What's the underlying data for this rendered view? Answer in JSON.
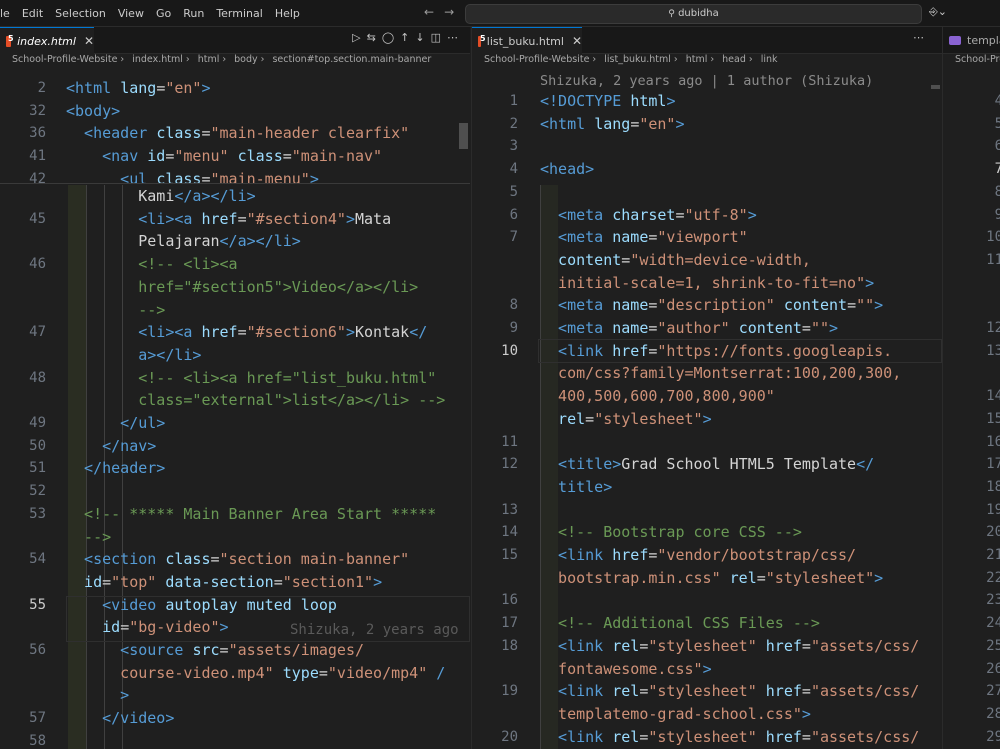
{
  "menu": [
    "le",
    "Edit",
    "Selection",
    "View",
    "Go",
    "Run",
    "Terminal",
    "Help"
  ],
  "search": "dubidha",
  "left": {
    "tab": "index.html",
    "breadcrumb": [
      "School-Profile-Website",
      "index.html",
      "html",
      "body",
      "section#top.section.main-banner"
    ],
    "sticky": [
      {
        "n": "2",
        "t": [
          [
            "tag",
            "<html "
          ],
          [
            "atn",
            "lang"
          ],
          [
            "pl",
            "="
          ],
          [
            "str",
            "\"en\""
          ],
          [
            "tag",
            ">"
          ]
        ]
      },
      {
        "n": "32",
        "t": [
          [
            "tag",
            "<body>"
          ]
        ]
      },
      {
        "n": "36",
        "t": [
          [
            "tag",
            "  <header "
          ],
          [
            "atn",
            "class"
          ],
          [
            "pl",
            "="
          ],
          [
            "str",
            "\"main-header clearfix\""
          ]
        ]
      },
      {
        "n": "41",
        "t": [
          [
            "tag",
            "    <nav "
          ],
          [
            "atn",
            "id"
          ],
          [
            "pl",
            "="
          ],
          [
            "str",
            "\"menu\" "
          ],
          [
            "atn",
            "class"
          ],
          [
            "pl",
            "="
          ],
          [
            "str",
            "\"main-nav\""
          ]
        ]
      },
      {
        "n": "42",
        "t": [
          [
            "tag",
            "      <ul "
          ],
          [
            "atn",
            "class"
          ],
          [
            "pl",
            "="
          ],
          [
            "str",
            "\"main-menu\""
          ],
          [
            "tag",
            ">"
          ]
        ]
      }
    ],
    "lines": [
      {
        "n": "",
        "t": [
          [
            "pl",
            "        Kami"
          ],
          [
            "tag",
            "</a></li>"
          ]
        ]
      },
      {
        "n": "45",
        "t": [
          [
            "tag",
            "        <li><a "
          ],
          [
            "atn",
            "href"
          ],
          [
            "pl",
            "="
          ],
          [
            "str",
            "\"#section4\""
          ],
          [
            "tag",
            ">"
          ],
          [
            "pl",
            "Mata"
          ]
        ]
      },
      {
        "n": "",
        "t": [
          [
            "pl",
            "        Pelajaran"
          ],
          [
            "tag",
            "</a></li>"
          ]
        ]
      },
      {
        "n": "46",
        "t": [
          [
            "cm",
            "        <!-- <li><a"
          ]
        ]
      },
      {
        "n": "",
        "t": [
          [
            "cm",
            "        href=\"#section5\">Video</a></li>"
          ]
        ]
      },
      {
        "n": "",
        "t": [
          [
            "cm",
            "        -->"
          ]
        ]
      },
      {
        "n": "47",
        "t": [
          [
            "tag",
            "        <li><a "
          ],
          [
            "atn",
            "href"
          ],
          [
            "pl",
            "="
          ],
          [
            "str",
            "\"#section6\""
          ],
          [
            "tag",
            ">"
          ],
          [
            "pl",
            "Kontak"
          ],
          [
            "tag",
            "</"
          ]
        ]
      },
      {
        "n": "",
        "t": [
          [
            "tag",
            "        a></li>"
          ]
        ]
      },
      {
        "n": "48",
        "t": [
          [
            "cm",
            "        <!-- <li><a href=\"list_buku.html\""
          ]
        ]
      },
      {
        "n": "",
        "t": [
          [
            "cm",
            "        class=\"external\">list</a></li> -->"
          ]
        ]
      },
      {
        "n": "49",
        "t": [
          [
            "tag",
            "      </ul>"
          ]
        ]
      },
      {
        "n": "50",
        "t": [
          [
            "tag",
            "    </nav>"
          ]
        ]
      },
      {
        "n": "51",
        "t": [
          [
            "tag",
            "  </header>"
          ]
        ]
      },
      {
        "n": "52",
        "t": []
      },
      {
        "n": "53",
        "t": [
          [
            "cm",
            "  <!-- ***** Main Banner Area Start *****"
          ]
        ]
      },
      {
        "n": "",
        "t": [
          [
            "cm",
            "  -->"
          ]
        ]
      },
      {
        "n": "54",
        "t": [
          [
            "tag",
            "  <section "
          ],
          [
            "atn",
            "class"
          ],
          [
            "pl",
            "="
          ],
          [
            "str",
            "\"section main-banner\""
          ]
        ]
      },
      {
        "n": "",
        "t": [
          [
            "atn",
            "  id"
          ],
          [
            "pl",
            "="
          ],
          [
            "str",
            "\"top\" "
          ],
          [
            "atn",
            "data-section"
          ],
          [
            "pl",
            "="
          ],
          [
            "str",
            "\"section1\""
          ],
          [
            "tag",
            ">"
          ]
        ]
      },
      {
        "n": "55",
        "t": [
          [
            "tag",
            "    <video "
          ],
          [
            "atn",
            "autoplay muted loop"
          ]
        ]
      },
      {
        "n": "",
        "t": [
          [
            "atn",
            "    id"
          ],
          [
            "pl",
            "="
          ],
          [
            "str",
            "\"bg-video\""
          ],
          [
            "tag",
            ">"
          ]
        ]
      },
      {
        "n": "56",
        "t": [
          [
            "tag",
            "      <source "
          ],
          [
            "atn",
            "src"
          ],
          [
            "pl",
            "="
          ],
          [
            "str",
            "\"assets/images/"
          ]
        ]
      },
      {
        "n": "",
        "t": [
          [
            "str",
            "      course-video.mp4\" "
          ],
          [
            "atn",
            "type"
          ],
          [
            "pl",
            "="
          ],
          [
            "str",
            "\"video/mp4\" "
          ],
          [
            "tag",
            "/"
          ]
        ]
      },
      {
        "n": "",
        "t": [
          [
            "tag",
            "      >"
          ]
        ]
      },
      {
        "n": "57",
        "t": [
          [
            "tag",
            "    </video>"
          ]
        ]
      },
      {
        "n": "58",
        "t": []
      }
    ],
    "blame": "Shizuka, 2 years ago"
  },
  "right": {
    "tab": "list_buku.html",
    "breadcrumb": [
      "School-Profile-Website",
      "list_buku.html",
      "html",
      "head",
      "link"
    ],
    "blame": "Shizuka, 2 years ago | 1 author (Shizuka)",
    "lines": [
      {
        "n": "1",
        "t": [
          [
            "tag",
            "<!DOCTYPE "
          ],
          [
            "atn",
            "html"
          ],
          [
            "tag",
            ">"
          ]
        ]
      },
      {
        "n": "2",
        "t": [
          [
            "tag",
            "<html "
          ],
          [
            "atn",
            "lang"
          ],
          [
            "pl",
            "="
          ],
          [
            "str",
            "\"en\""
          ],
          [
            "tag",
            ">"
          ]
        ]
      },
      {
        "n": "3",
        "t": []
      },
      {
        "n": "4",
        "t": [
          [
            "tag",
            "<head>"
          ]
        ]
      },
      {
        "n": "5",
        "t": []
      },
      {
        "n": "6",
        "t": [
          [
            "tag",
            "  <meta "
          ],
          [
            "atn",
            "charset"
          ],
          [
            "pl",
            "="
          ],
          [
            "str",
            "\"utf-8\""
          ],
          [
            "tag",
            ">"
          ]
        ]
      },
      {
        "n": "7",
        "t": [
          [
            "tag",
            "  <meta "
          ],
          [
            "atn",
            "name"
          ],
          [
            "pl",
            "="
          ],
          [
            "str",
            "\"viewport\""
          ]
        ]
      },
      {
        "n": "",
        "t": [
          [
            "atn",
            "  content"
          ],
          [
            "pl",
            "="
          ],
          [
            "str",
            "\"width=device-width,"
          ]
        ]
      },
      {
        "n": "",
        "t": [
          [
            "str",
            "  initial-scale=1, shrink-to-fit=no\""
          ],
          [
            "tag",
            ">"
          ]
        ]
      },
      {
        "n": "8",
        "t": [
          [
            "tag",
            "  <meta "
          ],
          [
            "atn",
            "name"
          ],
          [
            "pl",
            "="
          ],
          [
            "str",
            "\"description\" "
          ],
          [
            "atn",
            "content"
          ],
          [
            "pl",
            "="
          ],
          [
            "str",
            "\"\""
          ],
          [
            "tag",
            ">"
          ]
        ]
      },
      {
        "n": "9",
        "t": [
          [
            "tag",
            "  <meta "
          ],
          [
            "atn",
            "name"
          ],
          [
            "pl",
            "="
          ],
          [
            "str",
            "\"author\" "
          ],
          [
            "atn",
            "content"
          ],
          [
            "pl",
            "="
          ],
          [
            "str",
            "\"\""
          ],
          [
            "tag",
            ">"
          ]
        ]
      },
      {
        "n": "10",
        "t": [
          [
            "tag",
            "  <link "
          ],
          [
            "atn",
            "href"
          ],
          [
            "pl",
            "="
          ],
          [
            "str",
            "\"https://fonts.googleapis."
          ]
        ]
      },
      {
        "n": "",
        "t": [
          [
            "str",
            "  com/css?family=Montserrat:100,200,300,"
          ]
        ]
      },
      {
        "n": "",
        "t": [
          [
            "str",
            "  400,500,600,700,800,900\""
          ]
        ]
      },
      {
        "n": "",
        "t": [
          [
            "atn",
            "  rel"
          ],
          [
            "pl",
            "="
          ],
          [
            "str",
            "\"stylesheet\""
          ],
          [
            "tag",
            ">"
          ]
        ]
      },
      {
        "n": "11",
        "t": []
      },
      {
        "n": "12",
        "t": [
          [
            "tag",
            "  <title>"
          ],
          [
            "pl",
            "Grad School HTML5 Template"
          ],
          [
            "tag",
            "</"
          ]
        ]
      },
      {
        "n": "",
        "t": [
          [
            "tag",
            "  title>"
          ]
        ]
      },
      {
        "n": "13",
        "t": []
      },
      {
        "n": "14",
        "t": [
          [
            "cm",
            "  <!-- Bootstrap core CSS -->"
          ]
        ]
      },
      {
        "n": "15",
        "t": [
          [
            "tag",
            "  <link "
          ],
          [
            "atn",
            "href"
          ],
          [
            "pl",
            "="
          ],
          [
            "str",
            "\"vendor/bootstrap/css/"
          ]
        ]
      },
      {
        "n": "",
        "t": [
          [
            "str",
            "  bootstrap.min.css\" "
          ],
          [
            "atn",
            "rel"
          ],
          [
            "pl",
            "="
          ],
          [
            "str",
            "\"stylesheet\""
          ],
          [
            "tag",
            ">"
          ]
        ]
      },
      {
        "n": "16",
        "t": []
      },
      {
        "n": "17",
        "t": [
          [
            "cm",
            "  <!-- Additional CSS Files -->"
          ]
        ]
      },
      {
        "n": "18",
        "t": [
          [
            "tag",
            "  <link "
          ],
          [
            "atn",
            "rel"
          ],
          [
            "pl",
            "="
          ],
          [
            "str",
            "\"stylesheet\" "
          ],
          [
            "atn",
            "href"
          ],
          [
            "pl",
            "="
          ],
          [
            "str",
            "\"assets/css/"
          ]
        ]
      },
      {
        "n": "",
        "t": [
          [
            "str",
            "  fontawesome.css\""
          ],
          [
            "tag",
            ">"
          ]
        ]
      },
      {
        "n": "19",
        "t": [
          [
            "tag",
            "  <link "
          ],
          [
            "atn",
            "rel"
          ],
          [
            "pl",
            "="
          ],
          [
            "str",
            "\"stylesheet\" "
          ],
          [
            "atn",
            "href"
          ],
          [
            "pl",
            "="
          ],
          [
            "str",
            "\"assets/css/"
          ]
        ]
      },
      {
        "n": "",
        "t": [
          [
            "str",
            "  templatemo-grad-school.css\""
          ],
          [
            "tag",
            ">"
          ]
        ]
      },
      {
        "n": "20",
        "t": [
          [
            "tag",
            "  <link "
          ],
          [
            "atn",
            "rel"
          ],
          [
            "pl",
            "="
          ],
          [
            "str",
            "\"stylesheet\" "
          ],
          [
            "atn",
            "href"
          ],
          [
            "pl",
            "="
          ],
          [
            "str",
            "\"assets/css/"
          ]
        ]
      }
    ]
  },
  "third": {
    "tab": "templat",
    "breadcrumb": "School-Profi",
    "lines": [
      "4",
      "5",
      "6",
      "7",
      "8",
      "9",
      "10",
      "11",
      "",
      "",
      "12",
      "13",
      "",
      "14",
      "15",
      "16",
      "17",
      "18",
      "19",
      "20",
      "21",
      "22",
      "23",
      "24",
      "25",
      "26",
      "27",
      "28",
      "29",
      "30"
    ]
  }
}
